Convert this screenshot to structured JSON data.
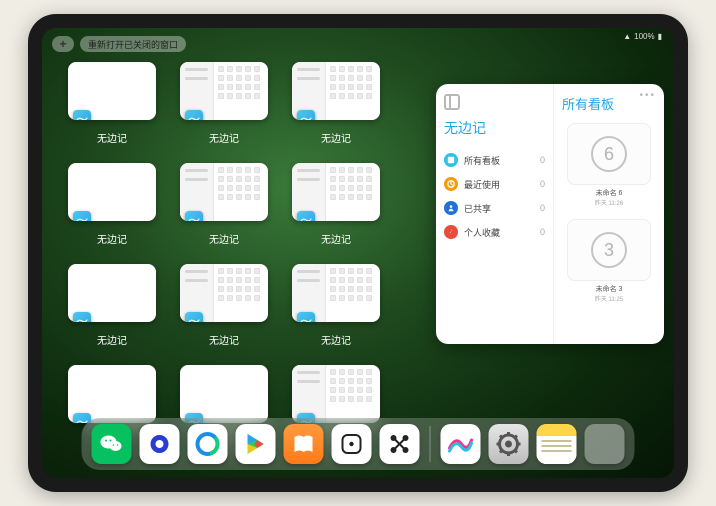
{
  "status": {
    "battery": "100%",
    "wifi": "􀙇"
  },
  "top": {
    "plus": "+",
    "reopen_label": "重新打开已关闭的窗口"
  },
  "app_label": "无边记",
  "panel": {
    "left_title": "无边记",
    "right_title": "所有看板",
    "menu": [
      {
        "label": "所有看板",
        "count": "0"
      },
      {
        "label": "最近使用",
        "count": "0"
      },
      {
        "label": "已共享",
        "count": "0"
      },
      {
        "label": "个人收藏",
        "count": "0"
      }
    ],
    "cards": [
      {
        "scribble": "6",
        "label": "未命名 6",
        "sub": "昨天 11:26"
      },
      {
        "scribble": "3",
        "label": "未命名 3",
        "sub": "昨天 11:25"
      }
    ]
  },
  "dock": {
    "apps": [
      {
        "name": "wechat",
        "bg": "#07c160",
        "glyph": "wechat"
      },
      {
        "name": "quark",
        "bg": "#ffffff",
        "glyph": "quark"
      },
      {
        "name": "qqbrowser",
        "bg": "#ffffff",
        "glyph": "qqb"
      },
      {
        "name": "play",
        "bg": "#ffffff",
        "glyph": "play"
      },
      {
        "name": "books",
        "bg": "linear-gradient(180deg,#ff9a3c,#ff7a1a)",
        "glyph": "books"
      },
      {
        "name": "dice",
        "bg": "#ffffff",
        "glyph": "dice"
      },
      {
        "name": "connect",
        "bg": "#ffffff",
        "glyph": "connect"
      }
    ],
    "recent": [
      {
        "name": "freeform",
        "bg": "#ffffff",
        "glyph": "freeform"
      },
      {
        "name": "settings",
        "bg": "linear-gradient(180deg,#e6e6e6,#bdbdbd)",
        "glyph": "gear"
      },
      {
        "name": "notes",
        "bg": "#ffffff",
        "glyph": "notes"
      }
    ],
    "folder_colors": [
      "#3fbf6b",
      "#f0a030",
      "#2a80d0",
      "#28b0e0"
    ]
  },
  "thumb_variants": [
    "plain",
    "cal",
    "cal",
    "plain",
    "cal",
    "cal",
    "plain",
    "cal",
    "cal",
    "plain",
    "plain",
    "cal"
  ]
}
